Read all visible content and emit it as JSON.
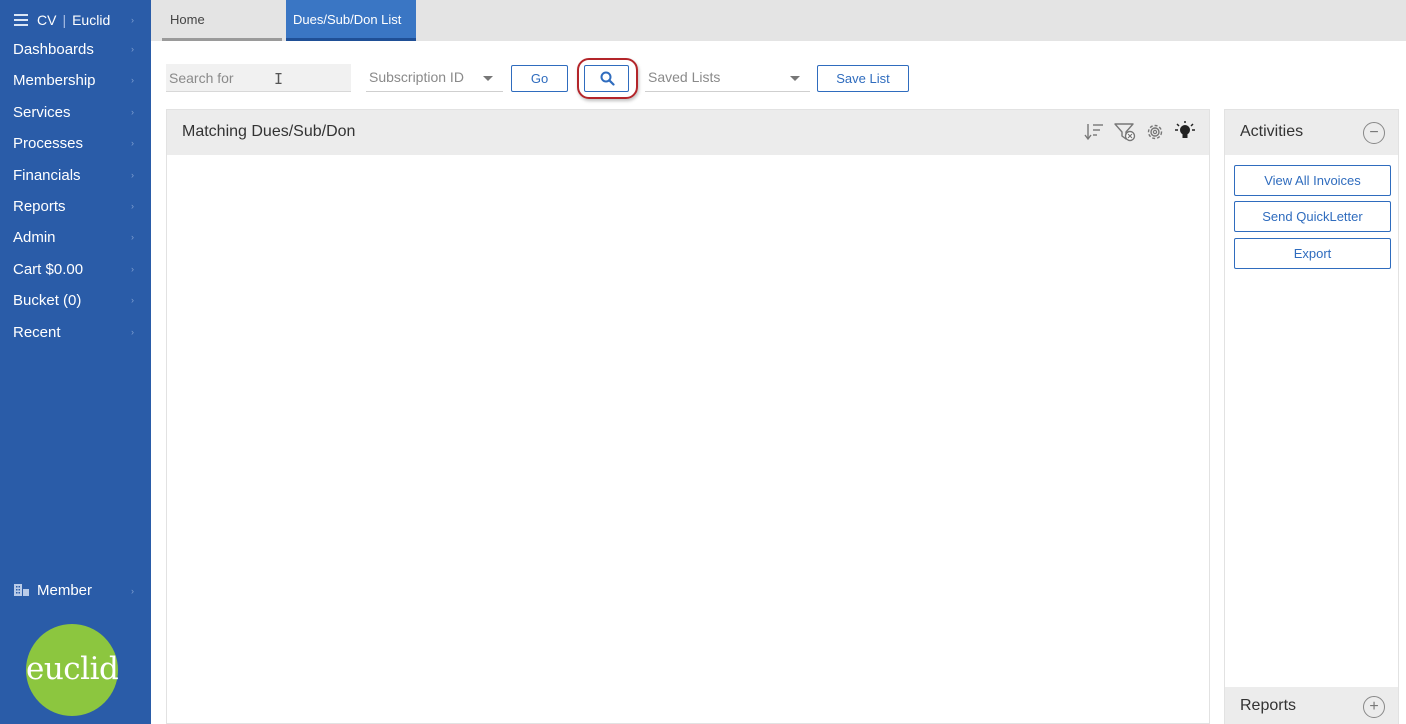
{
  "sidebar": {
    "brand_left": "CV",
    "brand_right": "Euclid",
    "items": [
      {
        "label": "Dashboards"
      },
      {
        "label": "Membership"
      },
      {
        "label": "Services"
      },
      {
        "label": "Processes"
      },
      {
        "label": "Financials"
      },
      {
        "label": "Reports"
      },
      {
        "label": "Admin"
      },
      {
        "label": "Cart $0.00"
      },
      {
        "label": "Bucket (0)"
      },
      {
        "label": "Recent"
      }
    ],
    "member_label": "Member",
    "logo_text": "euclid",
    "color": "#2a5ca8"
  },
  "tabs": {
    "home": "Home",
    "active": "Dues/Sub/Don List",
    "active_color": "#3a76c4"
  },
  "toolbar": {
    "search_placeholder": "Search for",
    "search_by": "Subscription ID",
    "go_label": "Go",
    "saved_lists": "Saved Lists",
    "save_list_label": "Save List",
    "search_icon": "magnifier-icon",
    "accent_color": "#2f6cbe",
    "highlight_color": "#b3252a"
  },
  "main": {
    "title": "Matching Dues/Sub/Don",
    "icons": [
      "sort-icon",
      "filter-icon",
      "settings-icon",
      "lightbulb-icon"
    ]
  },
  "activities": {
    "title": "Activities",
    "collapse_icon": "minus-circle-icon",
    "buttons": [
      "View All Invoices",
      "Send QuickLetter",
      "Export"
    ]
  },
  "reports": {
    "title": "Reports",
    "expand_icon": "plus-circle-icon"
  }
}
